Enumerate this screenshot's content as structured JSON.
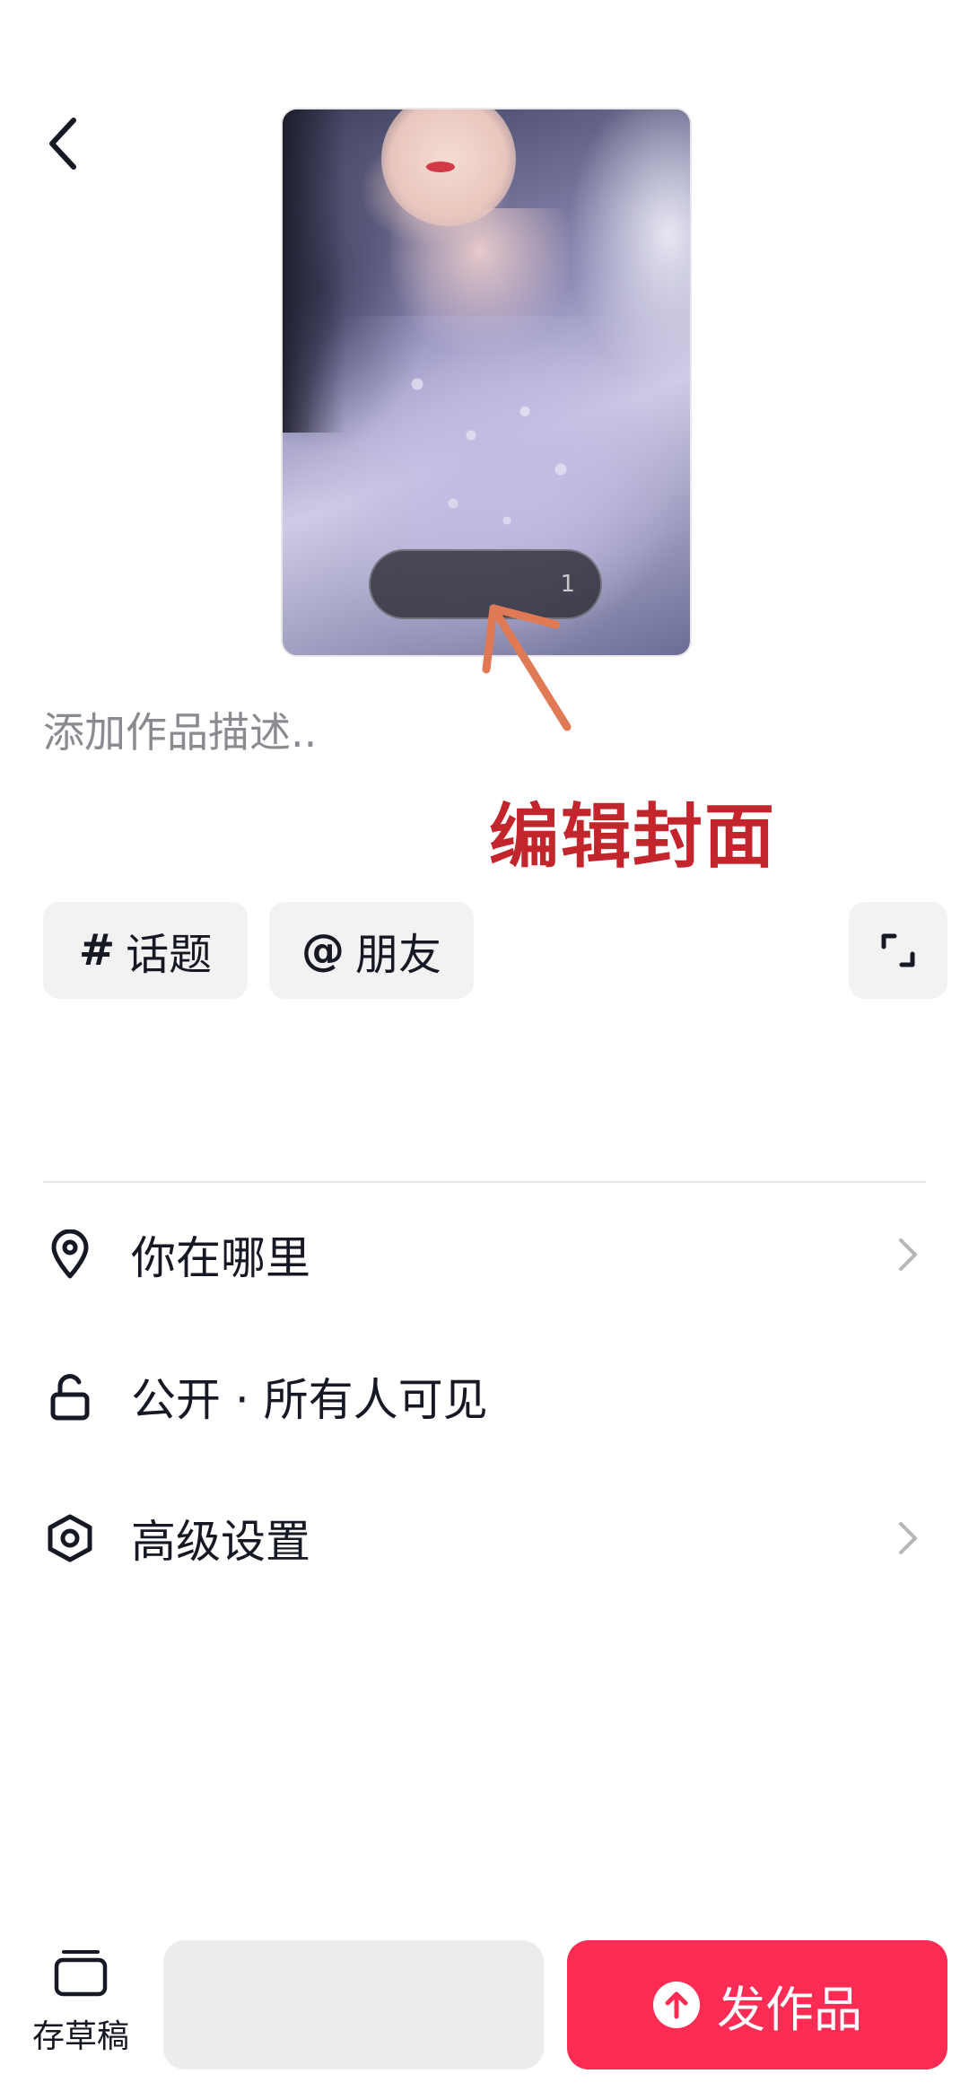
{
  "description": {
    "placeholder": "添加作品描述.."
  },
  "annotation": {
    "text": "编辑封面"
  },
  "cover": {
    "pill_text": "1"
  },
  "tags": {
    "topic": {
      "symbol": "#",
      "label": "话题"
    },
    "friend": {
      "symbol": "@",
      "label": "朋友"
    }
  },
  "settings": [
    {
      "label": "你在哪里",
      "icon": "location-pin-icon"
    },
    {
      "label": "公开 · 所有人可见",
      "icon": "unlock-icon"
    },
    {
      "label": "高级设置",
      "icon": "hexagon-settings-icon"
    }
  ],
  "bottom": {
    "draft_label": "存草稿",
    "publish_label": "发作品"
  },
  "colors": {
    "accent": "#fe2c55",
    "annotation": "#c2252c"
  }
}
